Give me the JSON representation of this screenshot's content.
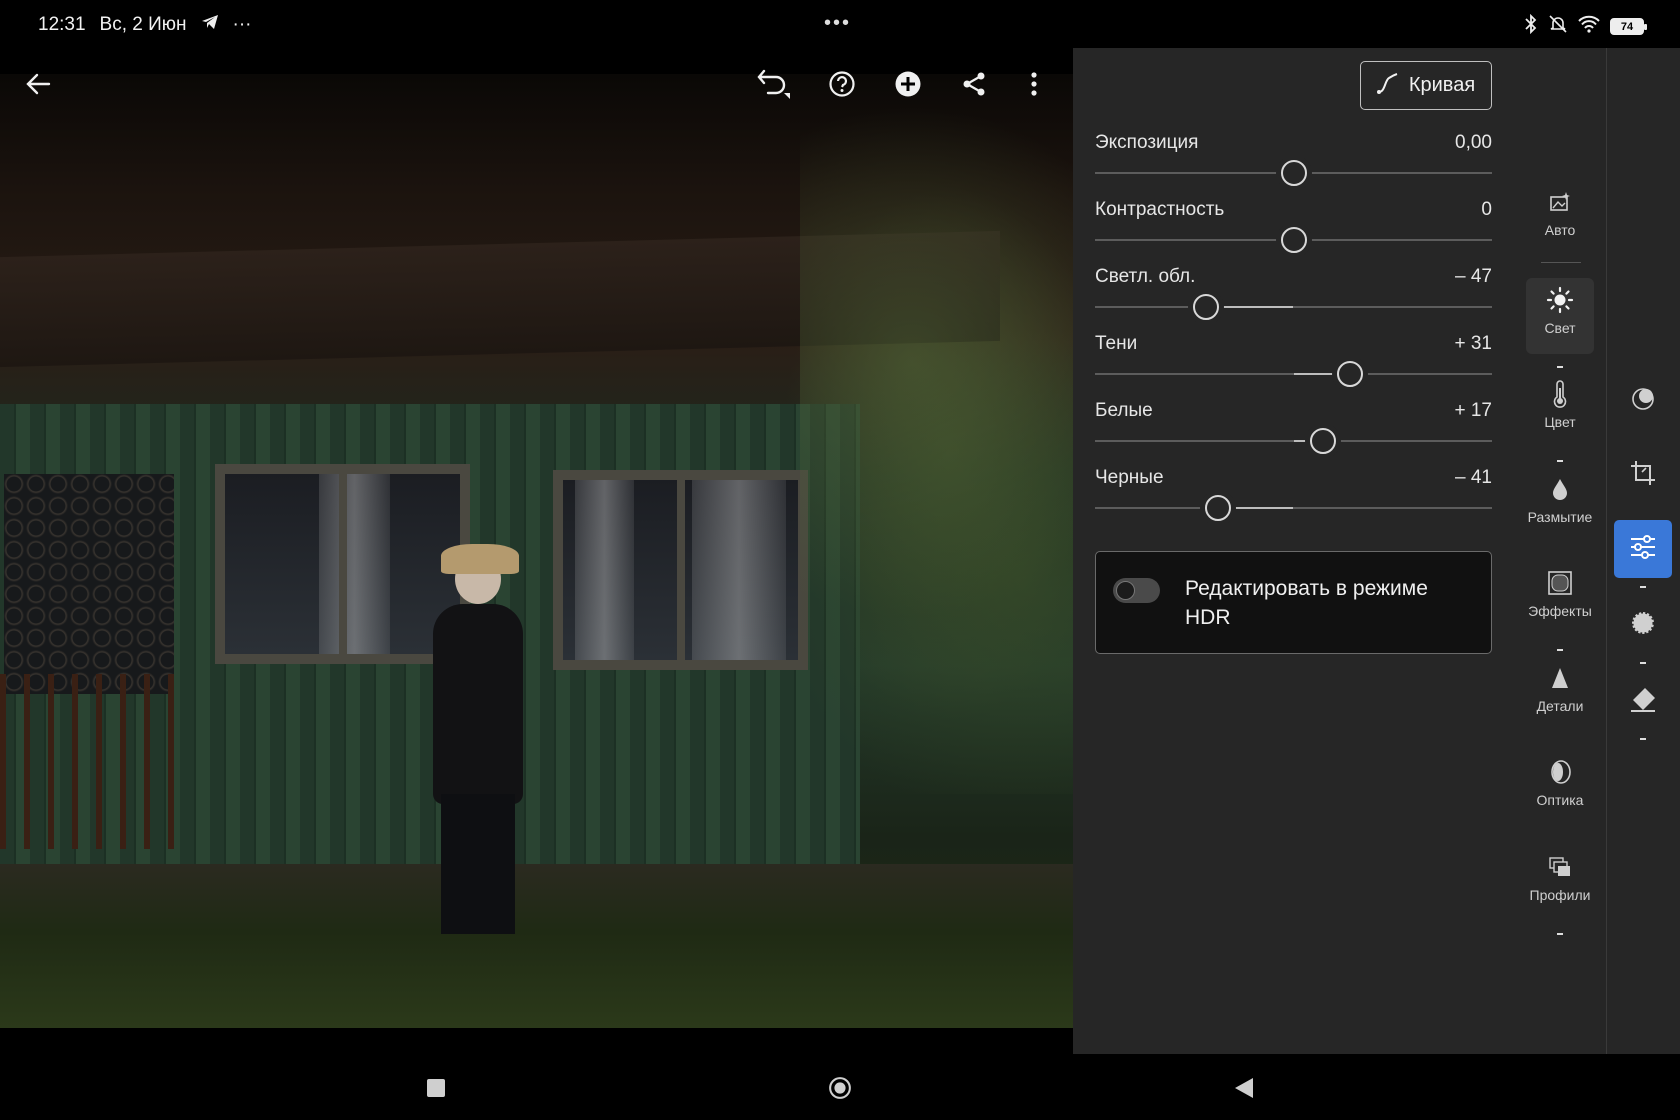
{
  "status": {
    "time": "12:31",
    "date": "Вс, 2 Июн",
    "more": "···",
    "center_dots": "•••",
    "battery": "74"
  },
  "panel": {
    "curve_label": "Кривая",
    "sliders": [
      {
        "label": "Экспозиция",
        "value": "0,00",
        "pos": 0.5
      },
      {
        "label": "Контрастность",
        "value": "0",
        "pos": 0.5
      },
      {
        "label": "Светл. обл.",
        "value": "– 47",
        "pos": 0.28
      },
      {
        "label": "Тени",
        "value": "+ 31",
        "pos": 0.643
      },
      {
        "label": "Белые",
        "value": "+ 17",
        "pos": 0.575
      },
      {
        "label": "Черные",
        "value": "– 41",
        "pos": 0.31
      }
    ],
    "hdr_label": "Редактировать в режиме HDR"
  },
  "categories": [
    {
      "name": "Авто",
      "icon": "auto-icon"
    },
    {
      "name": "Свет",
      "icon": "sun-icon",
      "active": true
    },
    {
      "name": "Цвет",
      "icon": "thermometer-icon"
    },
    {
      "name": "Размытие",
      "icon": "drop-icon"
    },
    {
      "name": "Эффекты",
      "icon": "effects-icon"
    },
    {
      "name": "Детали",
      "icon": "triangle-icon"
    },
    {
      "name": "Оптика",
      "icon": "lens-icon"
    },
    {
      "name": "Профили",
      "icon": "profiles-icon"
    }
  ],
  "colors": {
    "accent": "#3a78d8",
    "panel_bg": "#262626"
  }
}
